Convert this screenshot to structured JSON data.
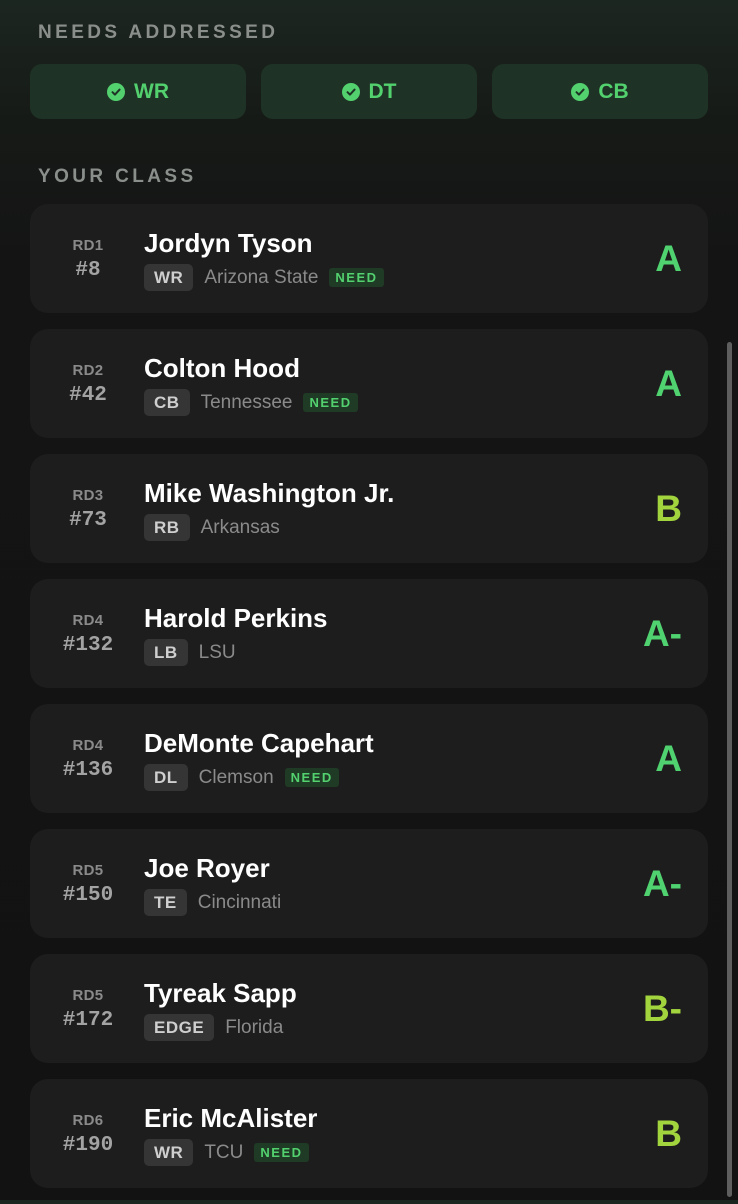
{
  "needs": {
    "title": "NEEDS ADDRESSED",
    "items": [
      {
        "label": "WR",
        "icon": "check-circle-icon"
      },
      {
        "label": "DT",
        "icon": "check-circle-icon"
      },
      {
        "label": "CB",
        "icon": "check-circle-icon"
      }
    ]
  },
  "your_class": {
    "title": "YOUR CLASS",
    "picks": [
      {
        "round": "RD1",
        "pick": "#8",
        "name": "Jordyn Tyson",
        "position": "WR",
        "school": "Arizona State",
        "need": "NEED",
        "grade": "A"
      },
      {
        "round": "RD2",
        "pick": "#42",
        "name": "Colton Hood",
        "position": "CB",
        "school": "Tennessee",
        "need": "NEED",
        "grade": "A"
      },
      {
        "round": "RD3",
        "pick": "#73",
        "name": "Mike Washington Jr.",
        "position": "RB",
        "school": "Arkansas",
        "need": "",
        "grade": "B"
      },
      {
        "round": "RD4",
        "pick": "#132",
        "name": "Harold Perkins",
        "position": "LB",
        "school": "LSU",
        "need": "",
        "grade": "A-"
      },
      {
        "round": "RD4",
        "pick": "#136",
        "name": "DeMonte Capehart",
        "position": "DL",
        "school": "Clemson",
        "need": "NEED",
        "grade": "A"
      },
      {
        "round": "RD5",
        "pick": "#150",
        "name": "Joe Royer",
        "position": "TE",
        "school": "Cincinnati",
        "need": "",
        "grade": "A-"
      },
      {
        "round": "RD5",
        "pick": "#172",
        "name": "Tyreak Sapp",
        "position": "EDGE",
        "school": "Florida",
        "need": "",
        "grade": "B-"
      },
      {
        "round": "RD6",
        "pick": "#190",
        "name": "Eric McAlister",
        "position": "WR",
        "school": "TCU",
        "need": "NEED",
        "grade": "B"
      }
    ]
  },
  "colors": {
    "accent_green": "#53d16f",
    "grade_a": "#4fd26f",
    "grade_b": "#a2d43d",
    "card_bg": "#1d1d1d",
    "chip_bg": "#1e3325"
  }
}
